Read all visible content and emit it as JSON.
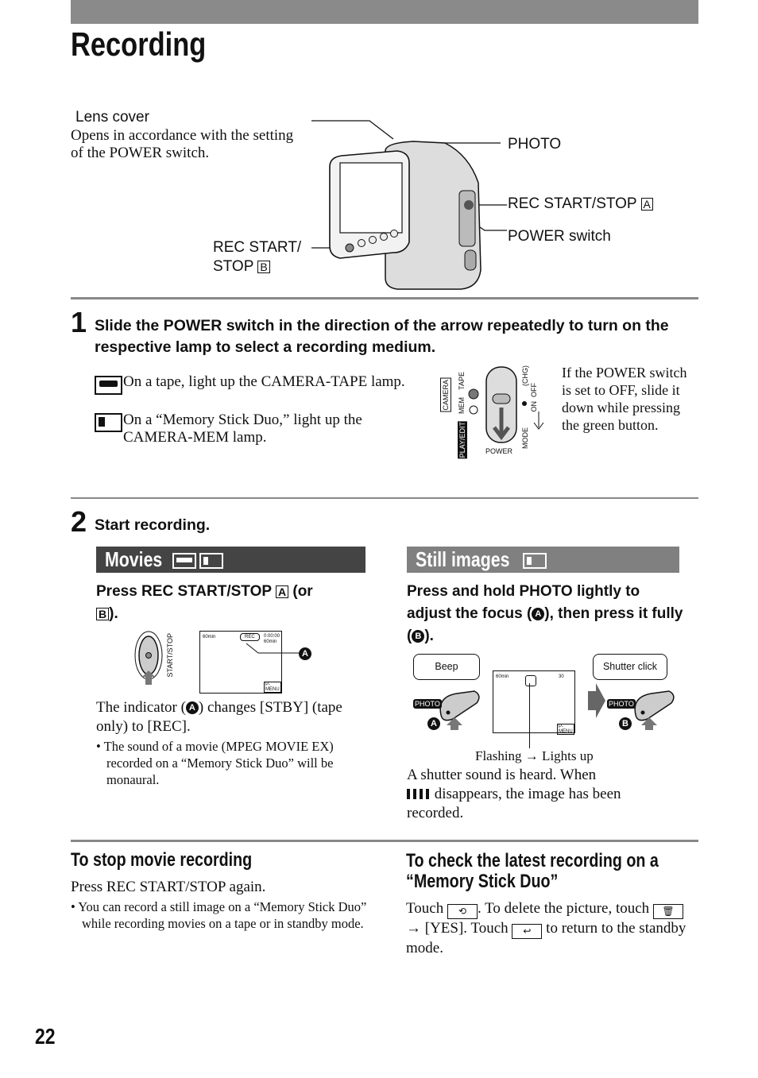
{
  "page": {
    "title": "Recording",
    "page_number": "22"
  },
  "figure": {
    "lens_cover": "Lens cover",
    "lens_cover_desc_1": "Opens in accordance with the setting",
    "lens_cover_desc_2": "of the POWER switch.",
    "photo": "PHOTO",
    "rec_a": "REC START/STOP",
    "rec_a_letter": "A",
    "power_switch": "POWER switch",
    "rec_b_1": "REC START/",
    "rec_b_2": "STOP",
    "rec_b_letter": "B"
  },
  "step1": {
    "number": "1",
    "text": "Slide the POWER switch in the direction of the arrow repeatedly to turn on the respective lamp to select a recording medium.",
    "tape_text": "On a tape, light up the CAMERA-TAPE lamp.",
    "mem_text": "On a “Memory Stick Duo,” light up the CAMERA-MEM lamp.",
    "switch_labels": {
      "camera": "CAMERA",
      "mem": "MEM",
      "tape": "TAPE",
      "play_edit": "PLAY/EDIT",
      "power": "POWER",
      "chg": "(CHG)",
      "off": "OFF",
      "on": "ON",
      "mode": "MODE"
    },
    "note": "If the POWER switch is set to OFF, slide it down while pressing the green button."
  },
  "step2": {
    "number": "2",
    "text": "Start recording."
  },
  "movies": {
    "heading": "Movies",
    "instruction_1": "Press REC START/STOP",
    "instruction_a": "A",
    "instruction_or": "(or",
    "instruction_b": "B",
    "instruction_end": ").",
    "button_label": "START/STOP",
    "screen": {
      "remaining": "60min",
      "rec": "REC",
      "counter": "0:00:00",
      "tape_remaining": "60min",
      "menu": "P-MENU"
    },
    "callout": "A",
    "desc_1": "The indicator (",
    "desc_a": "A",
    "desc_2": ") changes [STBY] (tape only) to [REC].",
    "bullet": "The sound of a movie (MPEG MOVIE EX) recorded on a “Memory Stick Duo” will be monaural."
  },
  "still": {
    "heading": "Still images",
    "instruction_1": "Press and hold PHOTO lightly to adjust the focus (",
    "instruction_a": "A",
    "instruction_2": "), then press it fully (",
    "instruction_b": "B",
    "instruction_3": ").",
    "beep": "Beep",
    "shutter": "Shutter click",
    "photo_btn": "PHOTO",
    "screen": {
      "remaining": "60min",
      "count": "30",
      "menu": "P-MENU"
    },
    "flashing": "Flashing → Lights up",
    "desc_1": "A shutter sound is heard. When",
    "desc_2": "disappears, the image has been recorded."
  },
  "stop": {
    "heading": "To stop movie recording",
    "text": "Press REC START/STOP again.",
    "bullet": "You can record a still image on a “Memory Stick Duo” while recording movies on a tape or in standby mode."
  },
  "check": {
    "heading_1": "To check the latest recording on a",
    "heading_2": "“Memory Stick Duo”",
    "t1": "Touch",
    "t2": ". To delete the picture, touch",
    "t3": "→ [YES]. Touch",
    "t4": "to return to the standby mode."
  },
  "colors": {
    "topbar": "#8a8a8a",
    "movies_band": "#444444",
    "still_band": "#808080"
  }
}
